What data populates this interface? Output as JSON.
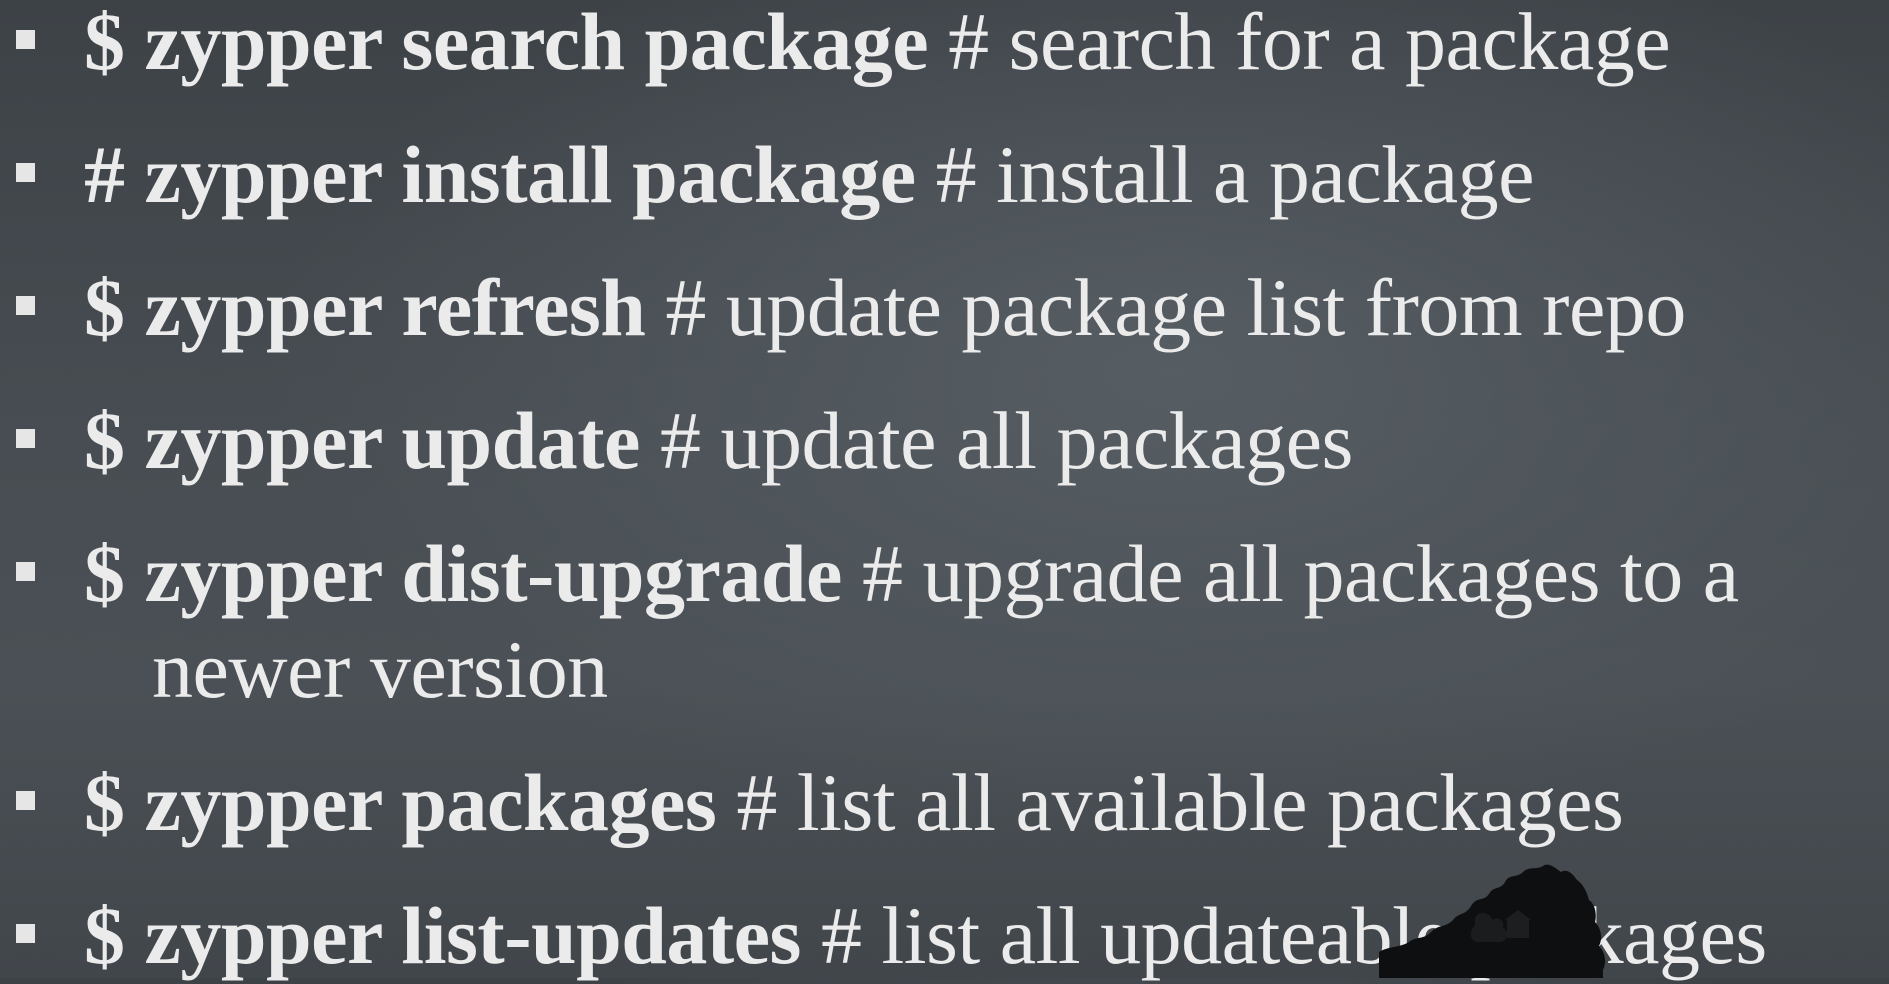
{
  "slide": {
    "bullets": [
      {
        "command": "$ zypper search package",
        "comment": " # search for a package"
      },
      {
        "command": "# zypper install package",
        "comment": " # install a package"
      },
      {
        "command": "$ zypper refresh",
        "comment": " # update package list from repo"
      },
      {
        "command": "$ zypper update",
        "comment": " # update all packages"
      },
      {
        "command": "$ zypper dist-upgrade",
        "comment": " # upgrade all packages to a",
        "continuation": "newer version"
      },
      {
        "command": "$ zypper packages",
        "comment": " # list all available packages"
      },
      {
        "command": "$ zypper list-updates",
        "comment": " # list all updateable packages"
      }
    ]
  },
  "colors": {
    "background": "#474d52",
    "text": "#ebebeb"
  }
}
